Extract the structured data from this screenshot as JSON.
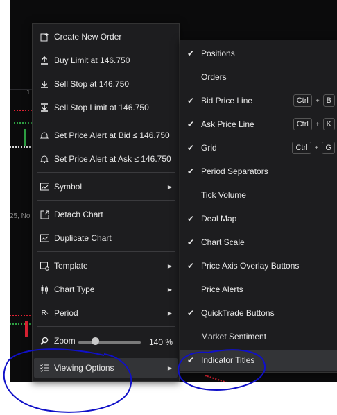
{
  "chart": {
    "partial_label_top": "1",
    "partial_label_mid": "25, No"
  },
  "main_menu": {
    "items": [
      {
        "label": "Create New Order",
        "icon": "new-order-icon"
      },
      {
        "label": "Buy Limit at 146.750",
        "icon": "upload-arrow-icon"
      },
      {
        "label": "Sell Stop at 146.750",
        "icon": "download-arrow-icon"
      },
      {
        "label": "Sell Stop Limit at 146.750",
        "icon": "download-arrow-bar-icon"
      },
      {
        "label": "Set Price Alert at Bid ≤ 146.750",
        "icon": "bell-icon"
      },
      {
        "label": "Set Price Alert at Ask ≤ 146.750",
        "icon": "bell-icon"
      },
      {
        "label": "Symbol",
        "icon": "chart-window-icon"
      },
      {
        "label": "Detach Chart",
        "icon": "detach-icon"
      },
      {
        "label": "Duplicate Chart",
        "icon": "duplicate-chart-icon"
      },
      {
        "label": "Template",
        "icon": "template-gear-icon"
      },
      {
        "label": "Chart Type",
        "icon": "candlestick-icon"
      },
      {
        "label": "Period",
        "icon": "period-icon"
      },
      {
        "label": "Zoom",
        "icon": "zoom-icon"
      },
      {
        "label": "Viewing Options",
        "icon": "list-check-icon"
      }
    ],
    "zoom_value": "140 %",
    "zoom_level_fraction": 0.27
  },
  "sub_menu": {
    "items": [
      {
        "label": "Positions",
        "checked": true
      },
      {
        "label": "Orders",
        "checked": false
      },
      {
        "label": "Bid Price Line",
        "checked": true,
        "shortcut": [
          "Ctrl",
          "+",
          "B"
        ]
      },
      {
        "label": "Ask Price Line",
        "checked": true,
        "shortcut": [
          "Ctrl",
          "+",
          "K"
        ]
      },
      {
        "label": "Grid",
        "checked": true,
        "shortcut": [
          "Ctrl",
          "+",
          "G"
        ]
      },
      {
        "label": "Period Separators",
        "checked": true
      },
      {
        "label": "Tick Volume",
        "checked": false
      },
      {
        "label": "Deal Map",
        "checked": true
      },
      {
        "label": "Chart Scale",
        "checked": true
      },
      {
        "label": "Price Axis Overlay Buttons",
        "checked": true
      },
      {
        "label": "Price Alerts",
        "checked": false
      },
      {
        "label": "QuickTrade Buttons",
        "checked": true
      },
      {
        "label": "Market Sentiment",
        "checked": false
      },
      {
        "label": "Indicator Titles",
        "checked": true
      }
    ]
  },
  "colors": {
    "menu_bg": "#1d1d1f",
    "highlight": "#333437",
    "annotation": "#1010c8"
  }
}
